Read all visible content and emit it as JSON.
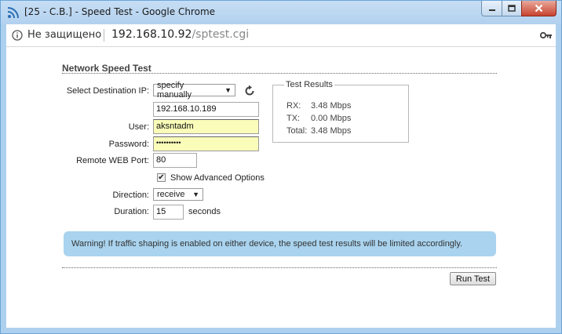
{
  "window": {
    "title": "[25 - C.B.] - Speed Test - Google Chrome"
  },
  "addressbar": {
    "security_label": "Не защищено",
    "url_host": "192.168.10.92",
    "url_path": "/sptest.cgi"
  },
  "page": {
    "section_title": "Network Speed Test",
    "labels": {
      "dest_ip": "Select Destination IP:",
      "user": "User:",
      "password": "Password:",
      "remote_port": "Remote WEB Port:",
      "advanced": "Show Advanced Options",
      "direction": "Direction:",
      "duration": "Duration:",
      "duration_unit": "seconds"
    },
    "fields": {
      "dest_mode": "specify manually",
      "dest_ip": "192.168.10.189",
      "user": "aksntadm",
      "password": "••••••••••",
      "remote_port": "80",
      "direction": "receive",
      "duration": "15",
      "advanced_checked": "✔"
    },
    "results": {
      "title": "Test Results",
      "rx_label": "RX:",
      "rx_value": "3.48 Mbps",
      "tx_label": "TX:",
      "tx_value": "0.00 Mbps",
      "total_label": "Total:",
      "total_value": "3.48 Mbps"
    },
    "warning": "Warning! If traffic shaping is enabled on either device, the speed test results will be limited accordingly.",
    "run_button": "Run Test"
  },
  "icons": {
    "app": "rss-feed-icon",
    "refresh": "refresh-icon",
    "info": "info-icon",
    "key": "key-icon"
  },
  "colors": {
    "warning_bg": "#a9d3ee",
    "autofill_bg": "#fafdb9",
    "titlebar": "#b9d5f1"
  }
}
